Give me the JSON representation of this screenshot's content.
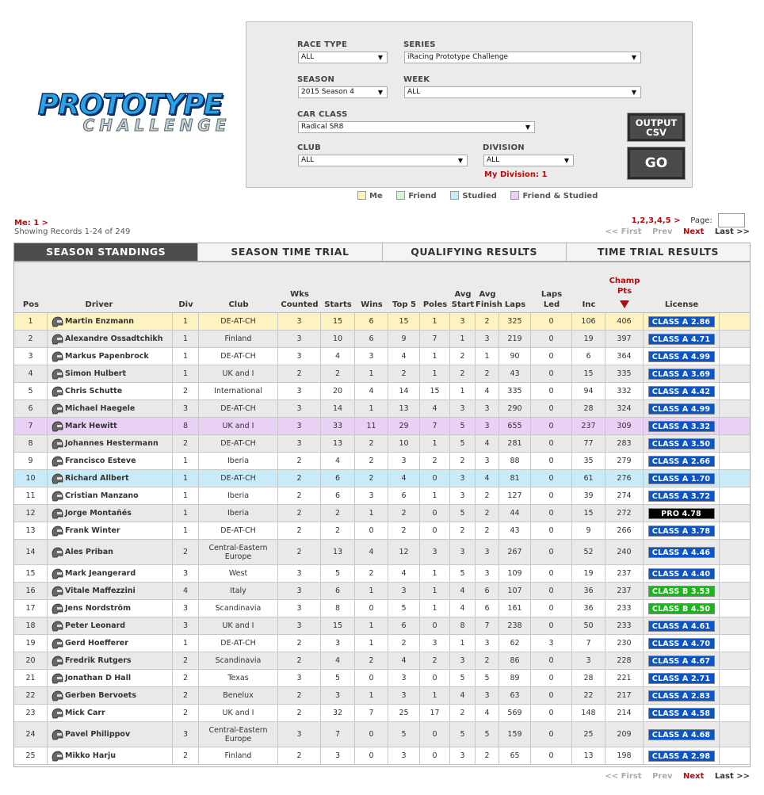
{
  "logo": {
    "line1": "PROTOTYPE",
    "line2": "CHALLENGE"
  },
  "filters": {
    "race_type": {
      "label": "RACE TYPE",
      "value": "ALL"
    },
    "series": {
      "label": "SERIES",
      "value": "iRacing Prototype Challenge"
    },
    "season": {
      "label": "SEASON",
      "value": "2015 Season 4"
    },
    "week": {
      "label": "WEEK",
      "value": "ALL"
    },
    "car_class": {
      "label": "CAR CLASS",
      "value": "Radical SR8"
    },
    "club": {
      "label": "CLUB",
      "value": "ALL"
    },
    "division": {
      "label": "DIVISION",
      "value": "ALL"
    },
    "my_division": "My Division: 1",
    "output_csv_line1": "OUTPUT",
    "output_csv_line2": "CSV",
    "go": "GO"
  },
  "legend": {
    "me": {
      "label": "Me",
      "color": "#fdf3c1"
    },
    "friend": {
      "label": "Friend",
      "color": "#d6f5d6"
    },
    "studied": {
      "label": "Studied",
      "color": "#c9ebf8"
    },
    "friend_studied": {
      "label": "Friend & Studied",
      "color": "#e9d1f5"
    }
  },
  "me_link": "Me: 1 >",
  "showing": "Showing Records 1-24 of 249",
  "pagination": {
    "pages": "1,2,3,4,5 >",
    "page_label": "Page:",
    "first": "<< First",
    "prev": "Prev",
    "next": "Next",
    "last": "Last >>"
  },
  "tabs": [
    "SEASON STANDINGS",
    "SEASON TIME TRIAL",
    "QUALIFYING RESULTS",
    "TIME TRIAL RESULTS"
  ],
  "columns": {
    "pos": "Pos",
    "driver": "Driver",
    "div": "Div",
    "club": "Club",
    "wks1": "Wks",
    "wks2": "Counted",
    "starts": "Starts",
    "wins": "Wins",
    "top5": "Top 5",
    "poles": "Poles",
    "avgstart1": "Avg",
    "avgstart2": "Start",
    "avgfinish1": "Avg",
    "avgfinish2": "Finish",
    "laps": "Laps",
    "lapsled1": "Laps",
    "lapsled2": "Led",
    "inc": "Inc",
    "champ1": "Champ",
    "champ2": "Pts",
    "license": "License"
  },
  "license_colors": {
    "A": "#0b55c8",
    "B": "#19b819",
    "PRO": "#000000"
  },
  "rows": [
    {
      "pos": "1",
      "driver": "Martin Enzmann",
      "div": "1",
      "club": "DE-AT-CH",
      "wks": "3",
      "starts": "15",
      "wins": "6",
      "top5": "15",
      "poles": "1",
      "avgstart": "3",
      "avgfinish": "2",
      "laps": "325",
      "lapsled": "0",
      "inc": "106",
      "pts": "406",
      "license": "CLASS A 2.86",
      "lic_type": "A",
      "hl": "me"
    },
    {
      "pos": "2",
      "driver": "Alexandre Ossadtchikh",
      "div": "1",
      "club": "Finland",
      "wks": "3",
      "starts": "10",
      "wins": "6",
      "top5": "9",
      "poles": "7",
      "avgstart": "1",
      "avgfinish": "3",
      "laps": "219",
      "lapsled": "0",
      "inc": "19",
      "pts": "397",
      "license": "CLASS A 4.71",
      "lic_type": "A",
      "hl": ""
    },
    {
      "pos": "3",
      "driver": "Markus Papenbrock",
      "div": "1",
      "club": "DE-AT-CH",
      "wks": "3",
      "starts": "4",
      "wins": "3",
      "top5": "4",
      "poles": "1",
      "avgstart": "2",
      "avgfinish": "1",
      "laps": "90",
      "lapsled": "0",
      "inc": "6",
      "pts": "364",
      "license": "CLASS A 4.99",
      "lic_type": "A",
      "hl": ""
    },
    {
      "pos": "4",
      "driver": "Simon Hulbert",
      "div": "1",
      "club": "UK and I",
      "wks": "2",
      "starts": "2",
      "wins": "1",
      "top5": "2",
      "poles": "1",
      "avgstart": "2",
      "avgfinish": "2",
      "laps": "43",
      "lapsled": "0",
      "inc": "15",
      "pts": "335",
      "license": "CLASS A 3.69",
      "lic_type": "A",
      "hl": ""
    },
    {
      "pos": "5",
      "driver": "Chris Schutte",
      "div": "2",
      "club": "International",
      "wks": "3",
      "starts": "20",
      "wins": "4",
      "top5": "14",
      "poles": "15",
      "avgstart": "1",
      "avgfinish": "4",
      "laps": "335",
      "lapsled": "0",
      "inc": "94",
      "pts": "332",
      "license": "CLASS A 4.42",
      "lic_type": "A",
      "hl": ""
    },
    {
      "pos": "6",
      "driver": "Michael Haegele",
      "div": "3",
      "club": "DE-AT-CH",
      "wks": "3",
      "starts": "14",
      "wins": "1",
      "top5": "13",
      "poles": "4",
      "avgstart": "3",
      "avgfinish": "3",
      "laps": "290",
      "lapsled": "0",
      "inc": "28",
      "pts": "324",
      "license": "CLASS A 4.99",
      "lic_type": "A",
      "hl": ""
    },
    {
      "pos": "7",
      "driver": "Mark Hewitt",
      "div": "8",
      "club": "UK and I",
      "wks": "3",
      "starts": "33",
      "wins": "11",
      "top5": "29",
      "poles": "7",
      "avgstart": "5",
      "avgfinish": "3",
      "laps": "655",
      "lapsled": "0",
      "inc": "237",
      "pts": "309",
      "license": "CLASS A 3.32",
      "lic_type": "A",
      "hl": "friendstudied"
    },
    {
      "pos": "8",
      "driver": "Johannes Hestermann",
      "div": "2",
      "club": "DE-AT-CH",
      "wks": "3",
      "starts": "13",
      "wins": "2",
      "top5": "10",
      "poles": "1",
      "avgstart": "5",
      "avgfinish": "4",
      "laps": "281",
      "lapsled": "0",
      "inc": "77",
      "pts": "283",
      "license": "CLASS A 3.50",
      "lic_type": "A",
      "hl": ""
    },
    {
      "pos": "9",
      "driver": "Francisco Esteve",
      "div": "1",
      "club": "Iberia",
      "wks": "2",
      "starts": "4",
      "wins": "2",
      "top5": "3",
      "poles": "2",
      "avgstart": "2",
      "avgfinish": "3",
      "laps": "88",
      "lapsled": "0",
      "inc": "35",
      "pts": "279",
      "license": "CLASS A 2.66",
      "lic_type": "A",
      "hl": ""
    },
    {
      "pos": "10",
      "driver": "Richard Allbert",
      "div": "1",
      "club": "DE-AT-CH",
      "wks": "2",
      "starts": "6",
      "wins": "2",
      "top5": "4",
      "poles": "0",
      "avgstart": "3",
      "avgfinish": "4",
      "laps": "81",
      "lapsled": "0",
      "inc": "61",
      "pts": "276",
      "license": "CLASS A 1.70",
      "lic_type": "A",
      "hl": "studied"
    },
    {
      "pos": "11",
      "driver": "Cristian Manzano",
      "div": "1",
      "club": "Iberia",
      "wks": "2",
      "starts": "6",
      "wins": "3",
      "top5": "6",
      "poles": "1",
      "avgstart": "3",
      "avgfinish": "2",
      "laps": "127",
      "lapsled": "0",
      "inc": "39",
      "pts": "274",
      "license": "CLASS A 3.72",
      "lic_type": "A",
      "hl": ""
    },
    {
      "pos": "12",
      "driver": "Jorge Montañés",
      "div": "1",
      "club": "Iberia",
      "wks": "2",
      "starts": "2",
      "wins": "1",
      "top5": "2",
      "poles": "0",
      "avgstart": "5",
      "avgfinish": "2",
      "laps": "44",
      "lapsled": "0",
      "inc": "15",
      "pts": "272",
      "license": "PRO 4.78",
      "lic_type": "PRO",
      "hl": ""
    },
    {
      "pos": "13",
      "driver": "Frank Winter",
      "div": "1",
      "club": "DE-AT-CH",
      "wks": "2",
      "starts": "2",
      "wins": "0",
      "top5": "2",
      "poles": "0",
      "avgstart": "2",
      "avgfinish": "2",
      "laps": "43",
      "lapsled": "0",
      "inc": "9",
      "pts": "266",
      "license": "CLASS A 3.78",
      "lic_type": "A",
      "hl": ""
    },
    {
      "pos": "14",
      "driver": "Ales Priban",
      "div": "2",
      "club": "Central-Eastern Europe",
      "wks": "2",
      "starts": "13",
      "wins": "4",
      "top5": "12",
      "poles": "3",
      "avgstart": "3",
      "avgfinish": "3",
      "laps": "267",
      "lapsled": "0",
      "inc": "52",
      "pts": "240",
      "license": "CLASS A 4.46",
      "lic_type": "A",
      "hl": ""
    },
    {
      "pos": "15",
      "driver": "Mark Jeangerard",
      "div": "3",
      "club": "West",
      "wks": "3",
      "starts": "5",
      "wins": "2",
      "top5": "4",
      "poles": "1",
      "avgstart": "5",
      "avgfinish": "3",
      "laps": "109",
      "lapsled": "0",
      "inc": "19",
      "pts": "237",
      "license": "CLASS A 4.40",
      "lic_type": "A",
      "hl": ""
    },
    {
      "pos": "16",
      "driver": "Vitale Maffezzini",
      "div": "4",
      "club": "Italy",
      "wks": "3",
      "starts": "6",
      "wins": "1",
      "top5": "3",
      "poles": "1",
      "avgstart": "4",
      "avgfinish": "6",
      "laps": "107",
      "lapsled": "0",
      "inc": "36",
      "pts": "237",
      "license": "CLASS B 3.53",
      "lic_type": "B",
      "hl": ""
    },
    {
      "pos": "17",
      "driver": "Jens Nordström",
      "div": "3",
      "club": "Scandinavia",
      "wks": "3",
      "starts": "8",
      "wins": "0",
      "top5": "5",
      "poles": "1",
      "avgstart": "4",
      "avgfinish": "6",
      "laps": "161",
      "lapsled": "0",
      "inc": "36",
      "pts": "233",
      "license": "CLASS B 4.50",
      "lic_type": "B",
      "hl": ""
    },
    {
      "pos": "18",
      "driver": "Peter Leonard",
      "div": "3",
      "club": "UK and I",
      "wks": "3",
      "starts": "15",
      "wins": "1",
      "top5": "6",
      "poles": "0",
      "avgstart": "8",
      "avgfinish": "7",
      "laps": "238",
      "lapsled": "0",
      "inc": "50",
      "pts": "233",
      "license": "CLASS A 4.61",
      "lic_type": "A",
      "hl": ""
    },
    {
      "pos": "19",
      "driver": "Gerd Hoefferer",
      "div": "1",
      "club": "DE-AT-CH",
      "wks": "2",
      "starts": "3",
      "wins": "1",
      "top5": "2",
      "poles": "3",
      "avgstart": "1",
      "avgfinish": "3",
      "laps": "62",
      "lapsled": "3",
      "inc": "7",
      "pts": "230",
      "license": "CLASS A 4.70",
      "lic_type": "A",
      "hl": ""
    },
    {
      "pos": "20",
      "driver": "Fredrik Rutgers",
      "div": "2",
      "club": "Scandinavia",
      "wks": "2",
      "starts": "4",
      "wins": "2",
      "top5": "4",
      "poles": "2",
      "avgstart": "3",
      "avgfinish": "2",
      "laps": "86",
      "lapsled": "0",
      "inc": "3",
      "pts": "228",
      "license": "CLASS A 4.67",
      "lic_type": "A",
      "hl": ""
    },
    {
      "pos": "21",
      "driver": "Jonathan D Hall",
      "div": "2",
      "club": "Texas",
      "wks": "3",
      "starts": "5",
      "wins": "0",
      "top5": "3",
      "poles": "0",
      "avgstart": "5",
      "avgfinish": "5",
      "laps": "89",
      "lapsled": "0",
      "inc": "28",
      "pts": "221",
      "license": "CLASS A 2.71",
      "lic_type": "A",
      "hl": ""
    },
    {
      "pos": "22",
      "driver": "Gerben Bervoets",
      "div": "2",
      "club": "Benelux",
      "wks": "2",
      "starts": "3",
      "wins": "1",
      "top5": "3",
      "poles": "1",
      "avgstart": "4",
      "avgfinish": "3",
      "laps": "63",
      "lapsled": "0",
      "inc": "22",
      "pts": "217",
      "license": "CLASS A 2.83",
      "lic_type": "A",
      "hl": ""
    },
    {
      "pos": "23",
      "driver": "Mick Carr",
      "div": "2",
      "club": "UK and I",
      "wks": "2",
      "starts": "32",
      "wins": "7",
      "top5": "25",
      "poles": "17",
      "avgstart": "2",
      "avgfinish": "4",
      "laps": "569",
      "lapsled": "0",
      "inc": "148",
      "pts": "214",
      "license": "CLASS A 4.58",
      "lic_type": "A",
      "hl": ""
    },
    {
      "pos": "24",
      "driver": "Pavel Philippov",
      "div": "3",
      "club": "Central-Eastern Europe",
      "wks": "3",
      "starts": "7",
      "wins": "0",
      "top5": "5",
      "poles": "0",
      "avgstart": "5",
      "avgfinish": "5",
      "laps": "159",
      "lapsled": "0",
      "inc": "25",
      "pts": "209",
      "license": "CLASS A 4.68",
      "lic_type": "A",
      "hl": ""
    },
    {
      "pos": "25",
      "driver": "Mikko Harju",
      "div": "2",
      "club": "Finland",
      "wks": "2",
      "starts": "3",
      "wins": "0",
      "top5": "3",
      "poles": "0",
      "avgstart": "3",
      "avgfinish": "2",
      "laps": "65",
      "lapsled": "0",
      "inc": "13",
      "pts": "198",
      "license": "CLASS A 2.98",
      "lic_type": "A",
      "hl": ""
    }
  ]
}
